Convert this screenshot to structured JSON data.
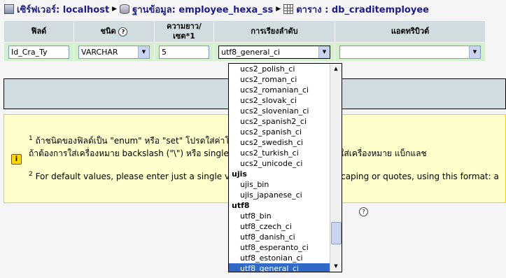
{
  "breadcrumb": {
    "server_label": "เซิร์ฟเวอร์: localhost",
    "database_label": "ฐานข้อมูล: employee_hexa_ss",
    "table_label": "ตาราง : db_craditemployee"
  },
  "table": {
    "headers": {
      "field": "ฟิลด์",
      "type": "ชนิด",
      "length_l1": "ความยาว/",
      "length_l2": "เซต*1",
      "collation": "การเรียงลำดับ",
      "attributes": "แอตทริบิวต์"
    },
    "row": {
      "field_value": "Id_Cra_Ty",
      "type_value": "VARCHAR",
      "length_value": "5",
      "collation_value": "utf8_general_ci",
      "attributes_value": ""
    }
  },
  "notice": {
    "footnote1_mark": "1",
    "line1": "ถ้าชนิดของฟิลด์เป็น \"enum\" หรือ \"set\" โปรดใส่ค่าโดยใช้รูปแบบ: 'a','b','c'...",
    "line2": "ถ้าต้องการใส่เครื่องหมาย backslash (\"\\\") หรือ single quote (\"'\") ในค่าเหล่านั้น ให้ใส่เครื่องหมาย แบ็กแลช",
    "footnote2_mark": "2",
    "line3": "For default values, please enter just a single value, without backslash escaping or quotes, using this format: a"
  },
  "collation_dropdown": {
    "options": [
      {
        "label": "ucs2_polish_ci",
        "group": false,
        "selected": false
      },
      {
        "label": "ucs2_roman_ci",
        "group": false,
        "selected": false
      },
      {
        "label": "ucs2_romanian_ci",
        "group": false,
        "selected": false
      },
      {
        "label": "ucs2_slovak_ci",
        "group": false,
        "selected": false
      },
      {
        "label": "ucs2_slovenian_ci",
        "group": false,
        "selected": false
      },
      {
        "label": "ucs2_spanish2_ci",
        "group": false,
        "selected": false
      },
      {
        "label": "ucs2_spanish_ci",
        "group": false,
        "selected": false
      },
      {
        "label": "ucs2_swedish_ci",
        "group": false,
        "selected": false
      },
      {
        "label": "ucs2_turkish_ci",
        "group": false,
        "selected": false
      },
      {
        "label": "ucs2_unicode_ci",
        "group": false,
        "selected": false
      },
      {
        "label": "ujis",
        "group": true,
        "selected": false
      },
      {
        "label": "ujis_bin",
        "group": false,
        "selected": false
      },
      {
        "label": "ujis_japanese_ci",
        "group": false,
        "selected": false
      },
      {
        "label": "utf8",
        "group": true,
        "selected": false
      },
      {
        "label": "utf8_bin",
        "group": false,
        "selected": false
      },
      {
        "label": "utf8_czech_ci",
        "group": false,
        "selected": false
      },
      {
        "label": "utf8_danish_ci",
        "group": false,
        "selected": false
      },
      {
        "label": "utf8_esperanto_ci",
        "group": false,
        "selected": false
      },
      {
        "label": "utf8_estonian_ci",
        "group": false,
        "selected": false
      },
      {
        "label": "utf8_general_ci",
        "group": false,
        "selected": true
      }
    ]
  },
  "colors": {
    "header_bg": "#d0dce0",
    "row_bg": "#d5f0cf",
    "notice_bg": "#ffffcc",
    "link": "#1d1d8a",
    "selected_bg": "#3169c6"
  }
}
